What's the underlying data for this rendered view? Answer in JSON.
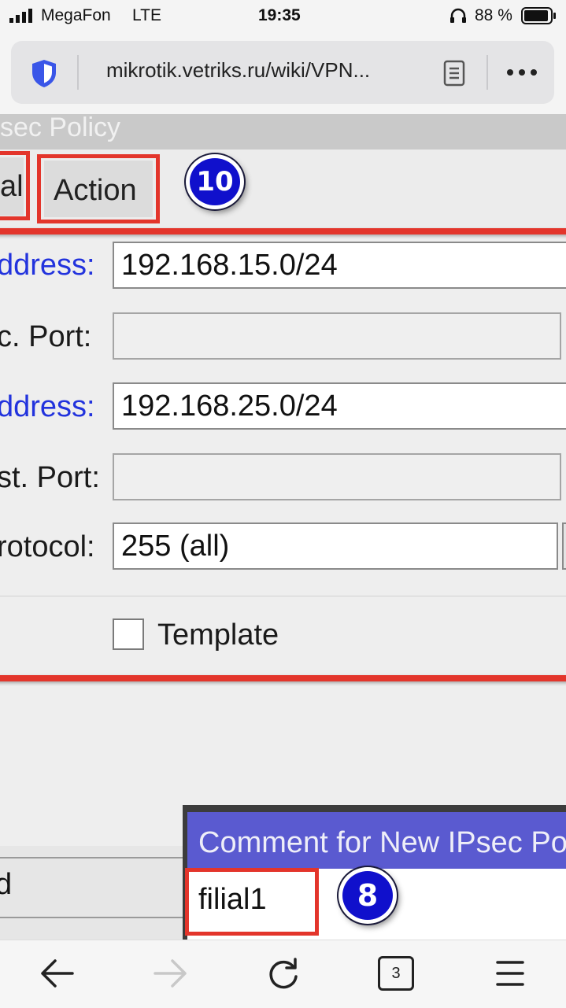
{
  "status_bar": {
    "carrier": "MegaFon",
    "network": "LTE",
    "time": "19:35",
    "battery": "88 %"
  },
  "browser": {
    "url": "mikrotik.vetriks.ru/wiki/VPN...",
    "tab_count": "3",
    "icons": [
      "shield-icon",
      "reader-icon",
      "more-icon",
      "back-icon",
      "forward-icon",
      "reload-icon",
      "tabs-icon",
      "menu-icon"
    ]
  },
  "window": {
    "title": "sec Policy",
    "tabs": [
      {
        "label": "al"
      },
      {
        "label": "Action"
      }
    ],
    "badge_top": "10"
  },
  "form": {
    "rows": [
      {
        "label": "ddress:",
        "value": "192.168.15.0/24",
        "kind": "input",
        "label_color": "#2233dd"
      },
      {
        "label": "c. Port:",
        "value": "",
        "kind": "disabled",
        "label_color": "#1a1a1a"
      },
      {
        "label": "ddress:",
        "value": "192.168.25.0/24",
        "kind": "input",
        "label_color": "#2233dd"
      },
      {
        "label": "st. Port:",
        "value": "",
        "kind": "disabled",
        "label_color": "#1a1a1a"
      },
      {
        "label": "rotocol:",
        "value": "255 (all)",
        "kind": "input",
        "label_color": "#1a1a1a"
      }
    ],
    "template_label": "Template",
    "template_checked": false
  },
  "dialog": {
    "left_fragment": "d",
    "title": "Comment for New IPsec Poli",
    "comment_value": "filial1",
    "badge_bottom": "8"
  },
  "colors": {
    "highlight_red": "#e3352b",
    "badge_blue": "#1010cc",
    "link_blue": "#2233dd",
    "dialog_title": "#5a5ad0"
  }
}
